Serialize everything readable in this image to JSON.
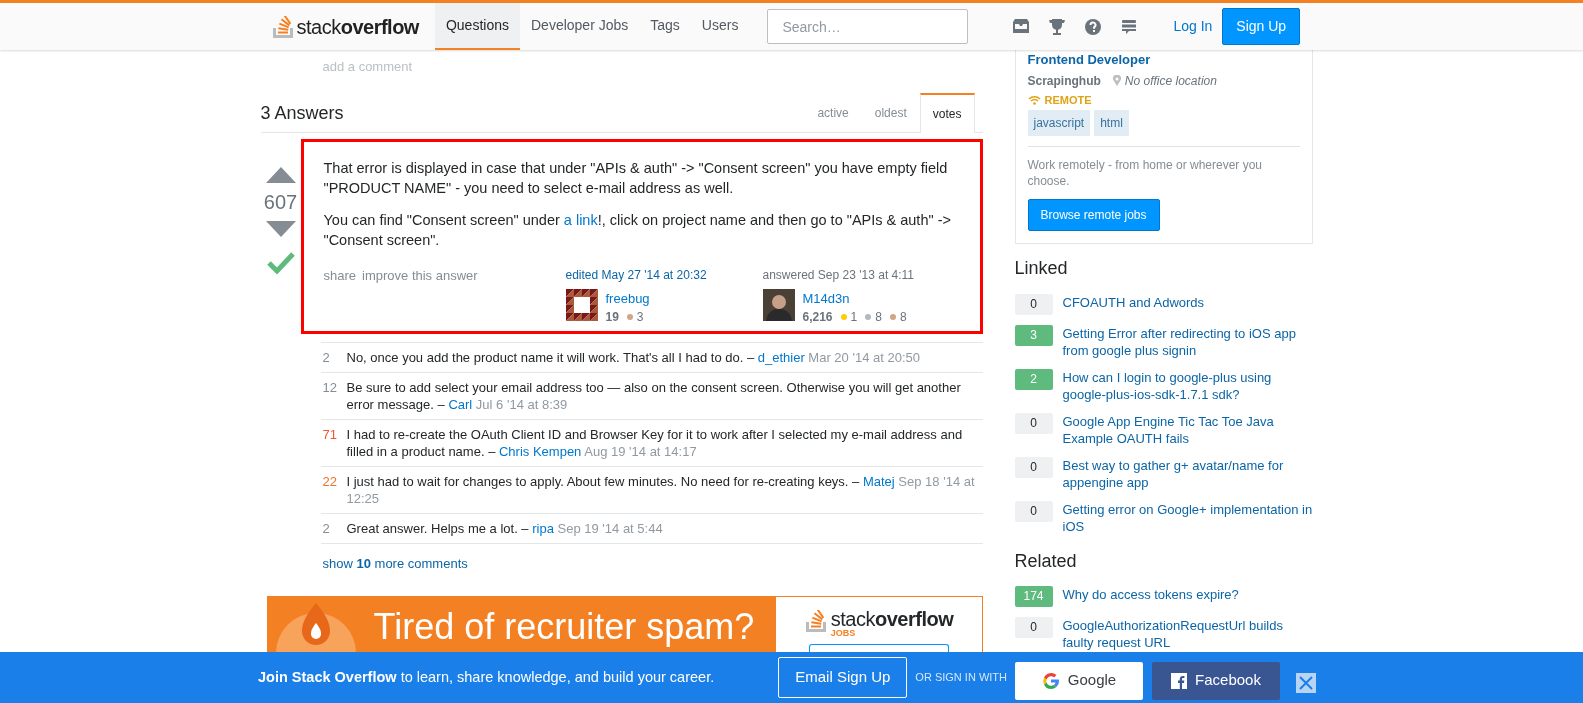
{
  "header": {
    "logo": {
      "word1": "stack",
      "word2": "overflow"
    },
    "nav": [
      {
        "label": "Questions",
        "selected": true
      },
      {
        "label": "Developer Jobs",
        "selected": false
      },
      {
        "label": "Tags",
        "selected": false
      },
      {
        "label": "Users",
        "selected": false
      }
    ],
    "search": {
      "placeholder": "Search…"
    },
    "login": "Log In",
    "signup": "Sign Up"
  },
  "add_comment": "add a comment",
  "answers": {
    "title": "3 Answers",
    "tabs": [
      {
        "label": "active",
        "selected": false
      },
      {
        "label": "oldest",
        "selected": false
      },
      {
        "label": "votes",
        "selected": true
      }
    ]
  },
  "answer": {
    "highlighted": true,
    "votes": "607",
    "accepted": true,
    "paragraphs": [
      [
        {
          "kind": "text",
          "text": "That error is displayed in case that under \"APIs & auth\" -> \"Consent screen\" you have empty field \"PRODUCT NAME\" - you need to select e-mail address as well."
        }
      ],
      [
        {
          "kind": "text",
          "text": "You can find \"Consent screen\" under "
        },
        {
          "kind": "link",
          "text": "a link"
        },
        {
          "kind": "text",
          "text": "!, click on project name and then go to \"APIs & auth\" -> \"Consent screen\"."
        }
      ]
    ],
    "menu": [
      "share",
      "improve this answer"
    ],
    "edited": {
      "label": "edited May 27 '14 at 20:32",
      "user": "freebug",
      "rep": "19",
      "badges": [
        {
          "color": "#d1a684",
          "count": "3"
        }
      ]
    },
    "answered": {
      "label": "answered Sep 23 '13 at 4:11",
      "user": "M14d3n",
      "rep": "6,216",
      "badges": [
        {
          "color": "#ffcc01",
          "count": "1"
        },
        {
          "color": "#b4b8bc",
          "count": "8"
        },
        {
          "color": "#d1a684",
          "count": "8"
        }
      ]
    }
  },
  "comments": [
    {
      "score": "2",
      "color": "#848d95",
      "text": "No, once you add the product name it will work. That's all I had to do. –",
      "user": "d_ethier",
      "date": "Mar 20 '14 at 20:50"
    },
    {
      "score": "12",
      "color": "#848d95",
      "text": "Be sure to add select your email address too — also on the consent screen. Otherwise you will get another error message. –",
      "user": "Carl",
      "date": "Jul 6 '14 at 8:39"
    },
    {
      "score": "71",
      "color": "#f4542a",
      "text": "I had to re-create the OAuth Client ID and Browser Key for it to work after I selected my e-mail address and filled in a product name. –",
      "user": "Chris Kempen",
      "date": "Aug 19 '14 at 14:17"
    },
    {
      "score": "22",
      "color": "#e8752a",
      "text": "I just had to wait for changes to apply. About few minutes. No need for re-creating keys. –",
      "user": "Matej",
      "date": "Sep 18 '14 at 12:25"
    },
    {
      "score": "2",
      "color": "#848d95",
      "text": "Great answer. Helps me a lot. –",
      "user": "ripa",
      "date": "Sep 19 '14 at 5:44"
    }
  ],
  "show_more": "show **10** more comments",
  "ad": {
    "title": "Tired of recruiter spam?",
    "logo_word1": "stack",
    "logo_word2": "overflow",
    "logo_sub": "JOBS"
  },
  "job": {
    "title": "Frontend Developer",
    "company": "Scrapinghub",
    "location": "No office location",
    "remote": "REMOTE",
    "tags": [
      "javascript",
      "html"
    ],
    "description": "Work remotely - from home or wherever you choose.",
    "button": "Browse remote jobs"
  },
  "linked": {
    "title": "Linked",
    "items": [
      {
        "count": "0",
        "answered": false,
        "title": "CFOAUTH and Adwords"
      },
      {
        "count": "3",
        "answered": true,
        "title": "Getting Error after redirecting to iOS app from google plus signin"
      },
      {
        "count": "2",
        "answered": true,
        "title": "How can I login to google-plus using google-plus-ios-sdk-1.7.1 sdk?"
      },
      {
        "count": "0",
        "answered": false,
        "title": "Google App Engine Tic Tac Toe Java Example OAUTH fails"
      },
      {
        "count": "0",
        "answered": false,
        "title": "Best way to gather g+ avatar/name for appengine app"
      },
      {
        "count": "0",
        "answered": false,
        "title": "Getting error on Google+ implementation in iOS"
      }
    ]
  },
  "related": {
    "title": "Related",
    "items": [
      {
        "count": "174",
        "answered": true,
        "title": "Why do access tokens expire?"
      },
      {
        "count": "0",
        "answered": false,
        "title": "GoogleAuthorizationRequestUrl builds faulty request URL"
      }
    ]
  },
  "banner": {
    "text": "**Join Stack Overflow** to learn, share knowledge, and build your career.",
    "email": "Email Sign Up",
    "or": "OR SIGN IN WITH",
    "google": "Google",
    "facebook": "Facebook"
  }
}
